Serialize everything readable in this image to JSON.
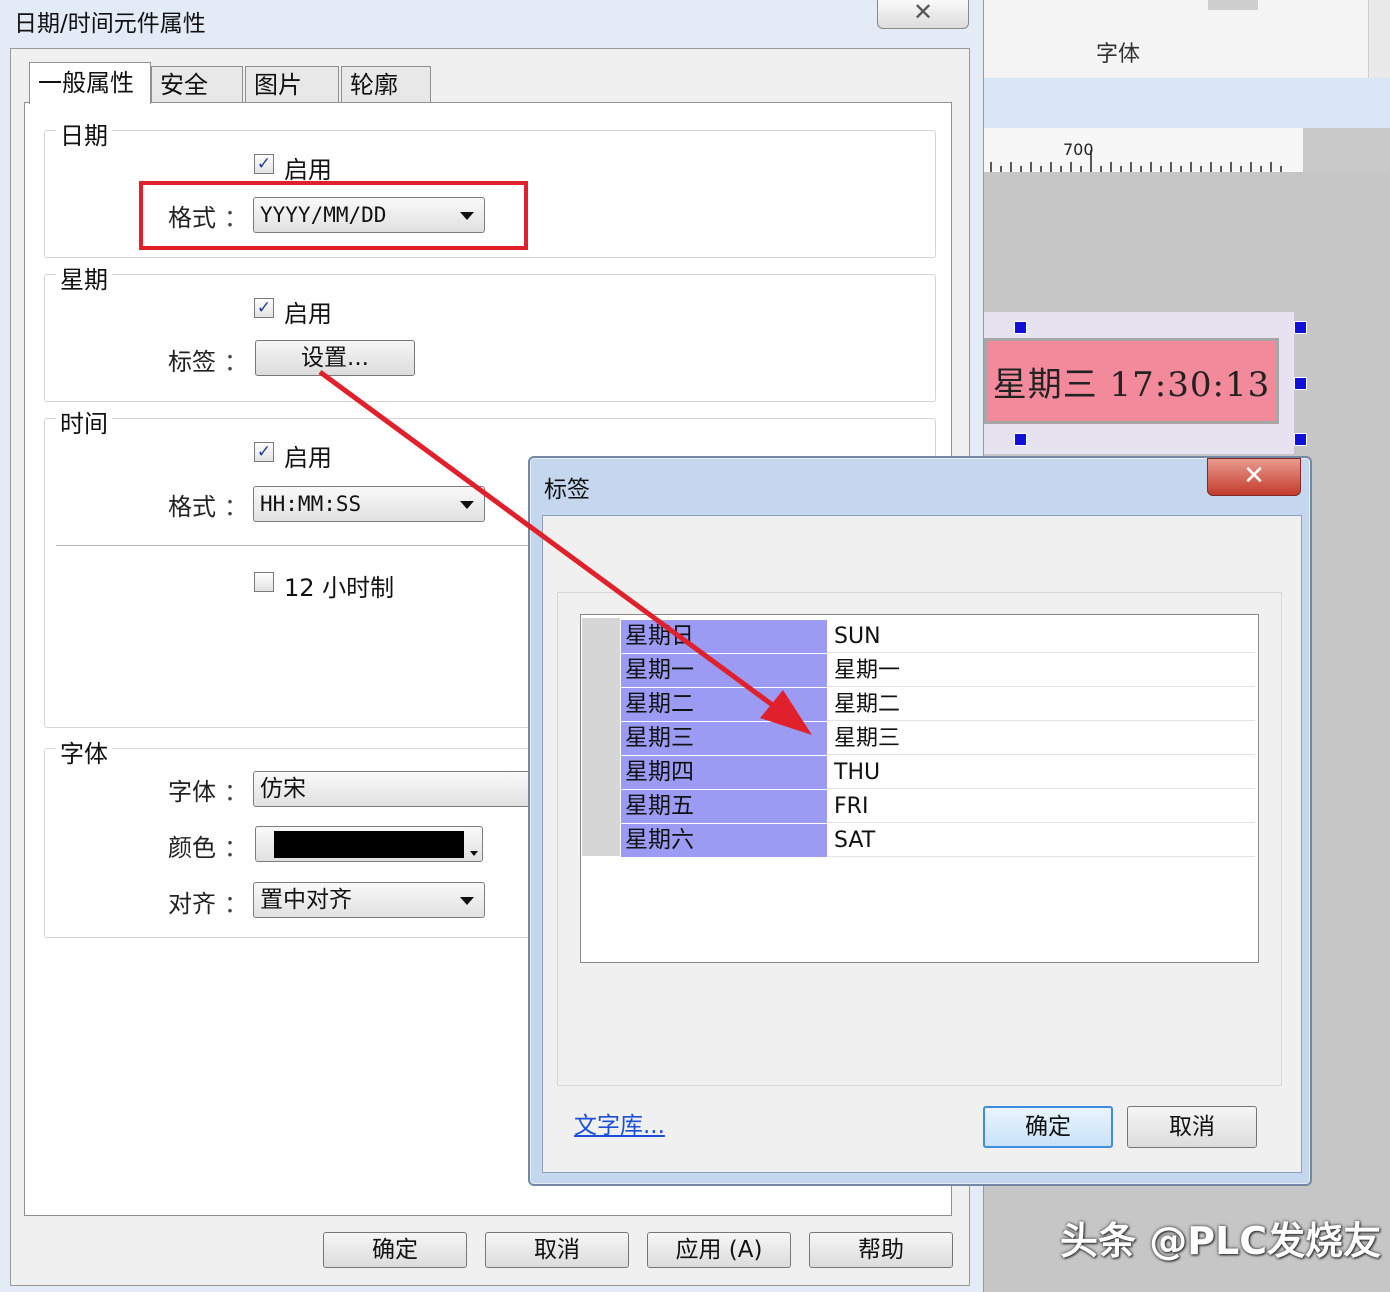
{
  "background": {
    "panel_label": "字体",
    "ruler_value": "700",
    "widget_text": "星期三 17:30:13",
    "watermark": "头条 @PLC发烧友"
  },
  "dialog": {
    "title": "日期/时间元件属性",
    "close_glyph": "✕",
    "tabs": [
      "一般属性",
      "安全",
      "图片",
      "轮廓"
    ],
    "date_group": {
      "label": "日期",
      "enable_label": "启用",
      "enabled": true,
      "format_label": "格式",
      "format_value": "YYYY/MM/DD"
    },
    "week_group": {
      "label": "星期",
      "enable_label": "启用",
      "enabled": true,
      "tag_label": "标签",
      "settings_button": "设置..."
    },
    "time_group": {
      "label": "时间",
      "enable_label": "启用",
      "enabled": true,
      "format_label": "格式",
      "format_value": "HH:MM:SS",
      "hour12_label": "12 小时制",
      "hour12_checked": false
    },
    "font_group": {
      "label": "字体",
      "font_label": "字体",
      "font_value": "仿宋",
      "color_label": "颜色",
      "color_value": "#000000",
      "align_label": "对齐",
      "align_value": "置中对齐"
    },
    "colon": "：",
    "buttons": [
      "确定",
      "取消",
      "应用 (A)",
      "帮助"
    ]
  },
  "tag_dialog": {
    "title": "标签",
    "close_glyph": "✕",
    "rows": [
      {
        "key": "星期日",
        "value": "SUN"
      },
      {
        "key": "星期一",
        "value": "星期一"
      },
      {
        "key": "星期二",
        "value": "星期二"
      },
      {
        "key": "星期三",
        "value": "星期三"
      },
      {
        "key": "星期四",
        "value": "THU"
      },
      {
        "key": "星期五",
        "value": "FRI"
      },
      {
        "key": "星期六",
        "value": "SAT"
      }
    ],
    "library_link": "文字库...",
    "ok_button": "确定",
    "cancel_button": "取消"
  },
  "colors": {
    "highlight_red": "#e0202a",
    "tag_key_bg": "#9b9bf4",
    "widget_bg": "#f28a9c",
    "handle_blue": "#1010d8"
  }
}
